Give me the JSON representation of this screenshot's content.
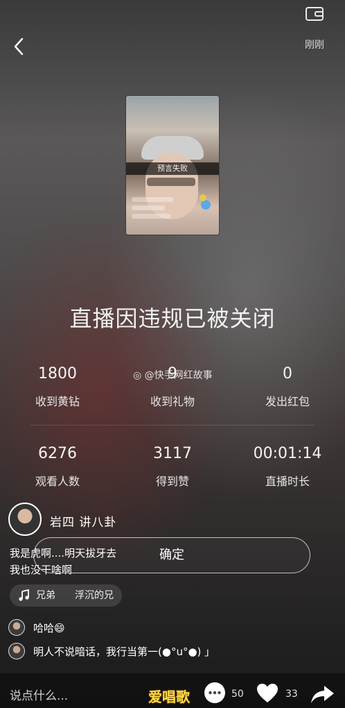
{
  "header": {
    "back_icon": "chevron-left-icon",
    "wallet_icon": "wallet-icon",
    "top_right_label": "刚刚"
  },
  "thumbnail": {
    "overlay_text": "预言失败"
  },
  "title": "直播因违规已被关闭",
  "watermark": "@快手网红故事",
  "stats_row1": [
    {
      "value": "1800",
      "label": "收到黄钻"
    },
    {
      "value": "9",
      "label": "收到礼物"
    },
    {
      "value": "0",
      "label": "发出红包"
    }
  ],
  "stats_row2": [
    {
      "value": "6276",
      "label": "观看人数"
    },
    {
      "value": "3117",
      "label": "得到赞"
    },
    {
      "value": "00:01:14",
      "label": "直播时长"
    }
  ],
  "user": {
    "name": "岩四 讲八卦"
  },
  "comment_lines": [
    "我是虎啊....明天拔牙去",
    "我也没干啥啊"
  ],
  "confirm_button": "确定",
  "music": {
    "icon": "music-note-icon",
    "part1": "兄弟",
    "part2": "浮沉的兄"
  },
  "comments": [
    {
      "text": "哈哈😄"
    },
    {
      "text": "明人不说暗话，我行当第一(●°u°●) 」"
    }
  ],
  "bottom": {
    "input_placeholder": "说点什么...",
    "brand": "爱唱歌",
    "comment_count": "50",
    "like_count": "33",
    "share_icon": "share-arrow-icon"
  }
}
